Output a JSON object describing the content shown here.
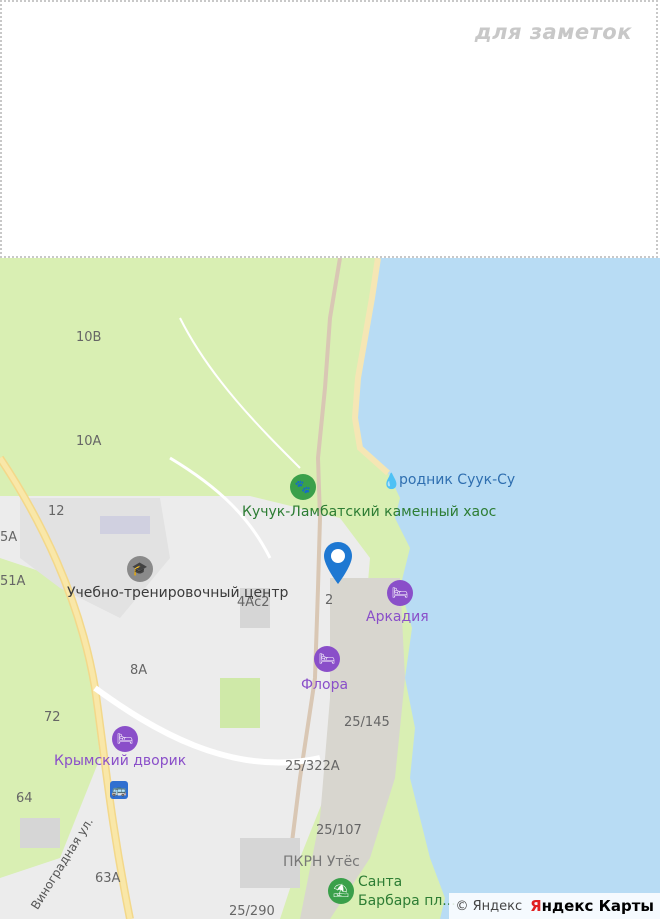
{
  "notes": {
    "label": "для заметок"
  },
  "map": {
    "house_numbers": [
      "10В",
      "10А",
      "12",
      "4Ас2",
      "8А",
      "72",
      "64",
      "63А",
      "2",
      "25/145",
      "25/322А",
      "25/107",
      "25/290",
      "5А",
      "51А"
    ],
    "places": {
      "reserve": "Кучук-Ламбатский каменный хаос",
      "spring": "родник Суук-Су",
      "training_center": "Учебно-тренировочный центр",
      "hotel_arkadiya": "Аркадия",
      "hotel_flora": "Флора",
      "hotel_dvorik": "Крымский дворик",
      "pkrn": "ПКРН Утёс",
      "beach": "Санта Барбара пл..."
    },
    "street": "Виноградная ул.",
    "copyright": "© Яндекс",
    "brand_y": "Я",
    "brand_rest": "ндекс Карты"
  },
  "colors": {
    "sea": "#b8dcf4",
    "forest": "#d9efb3",
    "urban": "#ececec",
    "road": "#f3d88a",
    "pin": "#1e78d2"
  }
}
